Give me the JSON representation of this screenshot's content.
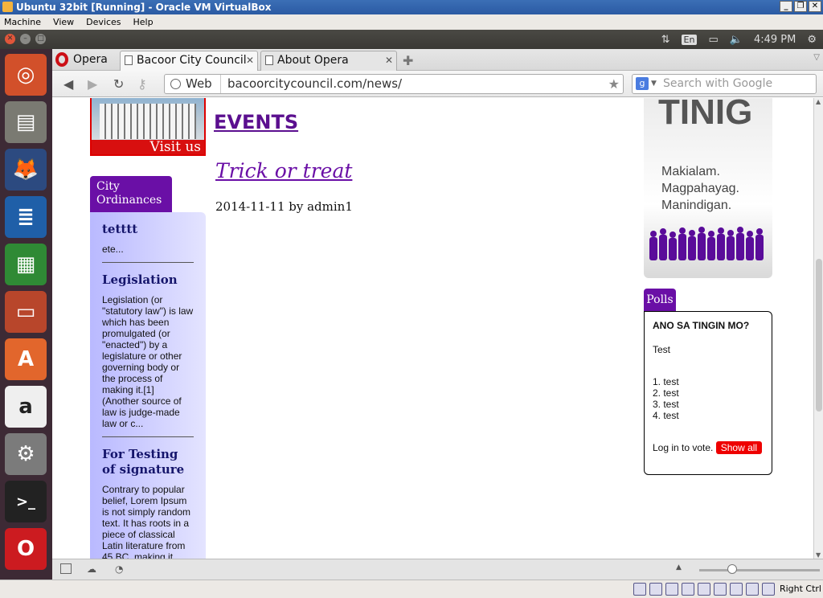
{
  "vbox": {
    "title": "Ubuntu 32bit [Running] - Oracle VM VirtualBox",
    "menu": [
      "Machine",
      "View",
      "Devices",
      "Help"
    ],
    "host_key": "Right Ctrl"
  },
  "panel": {
    "lang": "En",
    "time": "4:49 PM"
  },
  "browser": {
    "opera_label": "Opera",
    "tabs": [
      {
        "label": "Bacoor City Council",
        "active": true
      },
      {
        "label": "About Opera",
        "active": false
      }
    ],
    "web_label": "Web",
    "url": "bacoorcitycouncil.com/news/",
    "search_placeholder": "Search with Google"
  },
  "page": {
    "visit_us": "Visit us",
    "events_heading": "EVENTS",
    "post_title": "Trick or treat",
    "post_meta": "2014-11-11 by admin1",
    "ordinances_tab": "City Ordinances",
    "ordinances": [
      {
        "title": "tetttt",
        "body": "ete..."
      },
      {
        "title": "Legislation",
        "body": "Legislation (or \"statutory law\") is law which has been promulgated (or \"enacted\") by a legislature or other governing body or the process of making it.[1] (Another source of law is judge-made law or c..."
      },
      {
        "title": "For Testing of signature",
        "body": "Contrary to popular belief, Lorem Ipsum is not simply random text. It has roots in a piece of classical Latin literature from 45 BC, making it"
      }
    ],
    "tinig": {
      "title": "TINIG",
      "slogan": [
        "Makialam.",
        "Magpahayag.",
        "Manindigan."
      ]
    },
    "polls": {
      "tab": "Polls",
      "question": "ANO SA TINGIN MO?",
      "description": "Test",
      "options": [
        "1. test",
        "2. test",
        "3. test",
        "4. test"
      ],
      "login_text": "Log in to vote.",
      "show_all": "Show all"
    }
  }
}
